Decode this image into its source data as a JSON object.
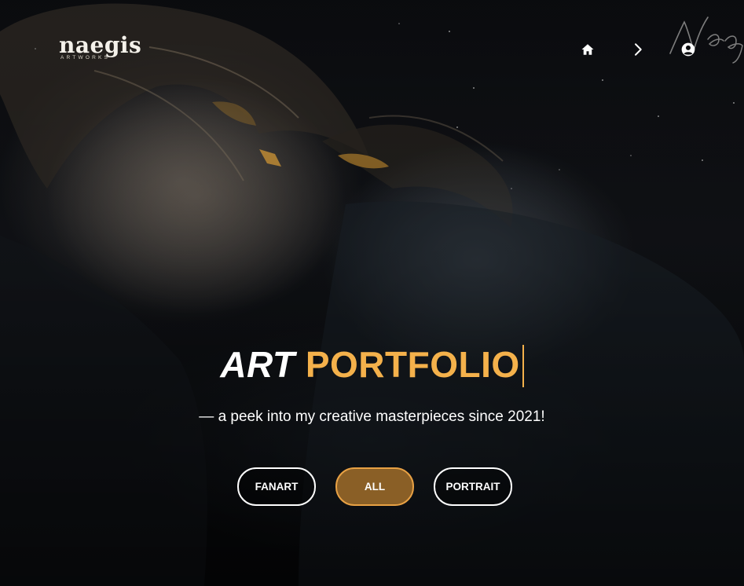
{
  "header": {
    "logo": {
      "wordmark": "naegis",
      "subtitle": "ARTWORKS"
    },
    "nav": [
      {
        "name": "home",
        "icon": "home-icon"
      },
      {
        "name": "next",
        "icon": "chevron-right-icon"
      },
      {
        "name": "account",
        "icon": "user-circle-icon"
      }
    ],
    "signature": "Naeg"
  },
  "hero": {
    "headline_word1": "ART",
    "headline_word2": "PORTFOLIO",
    "tagline": "— a peek into my creative masterpieces since 2021!"
  },
  "filters": {
    "items": [
      {
        "label": "FANART",
        "active": false
      },
      {
        "label": "ALL",
        "active": true
      },
      {
        "label": "PORTRAIT",
        "active": false
      }
    ]
  },
  "colors": {
    "accent": "#f4b14b",
    "active_fill": "#8a5f26",
    "active_border": "#e8a144",
    "background": "#08090c"
  }
}
